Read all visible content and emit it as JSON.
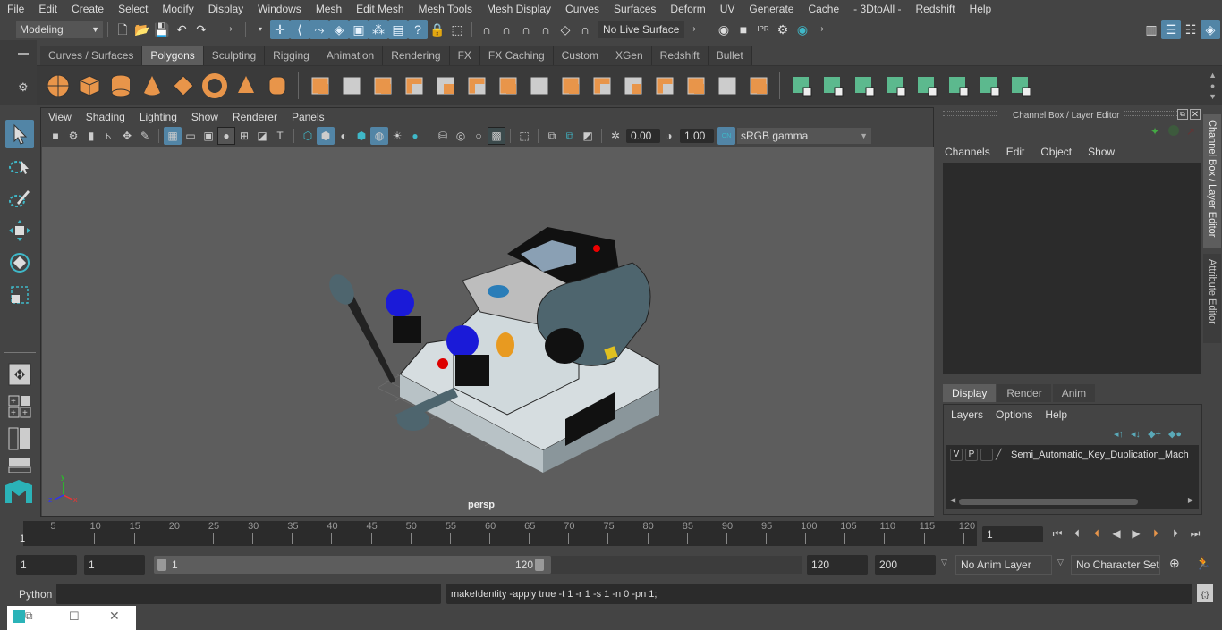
{
  "menubar": [
    "File",
    "Edit",
    "Create",
    "Select",
    "Modify",
    "Display",
    "Windows",
    "Mesh",
    "Edit Mesh",
    "Mesh Tools",
    "Mesh Display",
    "Curves",
    "Surfaces",
    "Deform",
    "UV",
    "Generate",
    "Cache",
    "- 3DtoAll -",
    "Redshift",
    "Help"
  ],
  "statusline": {
    "mode": "Modeling",
    "live_surface": "No Live Surface"
  },
  "shelf_tabs": [
    {
      "label": "Curves / Surfaces",
      "active": false
    },
    {
      "label": "Polygons",
      "active": true
    },
    {
      "label": "Sculpting",
      "active": false
    },
    {
      "label": "Rigging",
      "active": false
    },
    {
      "label": "Animation",
      "active": false
    },
    {
      "label": "Rendering",
      "active": false
    },
    {
      "label": "FX",
      "active": false
    },
    {
      "label": "FX Caching",
      "active": false
    },
    {
      "label": "Custom",
      "active": false
    },
    {
      "label": "XGen",
      "active": false
    },
    {
      "label": "Redshift",
      "active": false
    },
    {
      "label": "Bullet",
      "active": false
    }
  ],
  "shelf_icons": [
    "poly-sphere",
    "poly-cube",
    "poly-cylinder",
    "poly-cone",
    "poly-plane",
    "poly-torus",
    "poly-pyramid",
    "poly-pipe",
    "combine",
    "separate",
    "mirror",
    "smooth",
    "bevel",
    "bridge",
    "extrude",
    "multi-cut",
    "bridge-edge",
    "append",
    "bevel2",
    "edge-loop",
    "insert-loop",
    "mirror-cut",
    "slide",
    "merge",
    "uv-planar",
    "uv-cylindrical",
    "uv-spherical",
    "uv-automatic",
    "uv-unfold",
    "uv-editor",
    "uv-layout"
  ],
  "viewport": {
    "menu": [
      "View",
      "Shading",
      "Lighting",
      "Show",
      "Renderer",
      "Panels"
    ],
    "exposure": "0.00",
    "gamma": "1.00",
    "color_space": "sRGB gamma",
    "camera_label": "persp",
    "axis": {
      "x": "x",
      "y": "y",
      "z": "z"
    }
  },
  "channel_box": {
    "title": "Channel Box / Layer Editor",
    "menu": [
      "Channels",
      "Edit",
      "Object",
      "Show"
    ],
    "layer_tabs": [
      {
        "label": "Display",
        "active": true
      },
      {
        "label": "Render",
        "active": false
      },
      {
        "label": "Anim",
        "active": false
      }
    ],
    "layer_menu": [
      "Layers",
      "Options",
      "Help"
    ],
    "layers": [
      {
        "v": "V",
        "p": "P",
        "name": "Semi_Automatic_Key_Duplication_Mach"
      }
    ]
  },
  "side_tabs": [
    "Channel Box / Layer Editor",
    "Attribute Editor"
  ],
  "timeline": {
    "ticks": [
      5,
      10,
      15,
      20,
      25,
      30,
      35,
      40,
      45,
      50,
      55,
      60,
      65,
      70,
      75,
      80,
      85,
      90,
      95,
      100,
      105,
      110,
      115,
      120
    ],
    "current_marker": "1",
    "current_frame": "1"
  },
  "range": {
    "start": "1",
    "anim_start": "1",
    "slider_start": "1",
    "slider_end": "120",
    "end": "120",
    "anim_end": "200",
    "anim_layer": "No Anim Layer",
    "char_set": "No Character Set"
  },
  "command": {
    "language": "Python",
    "input": "",
    "result": "makeIdentity -apply true -t 1 -r 1 -s 1 -n 0 -pn 1;"
  },
  "colors": {
    "accent": "#5285a6",
    "shelf_orange": "#e8954a",
    "shelf_green": "#5cb98e"
  }
}
